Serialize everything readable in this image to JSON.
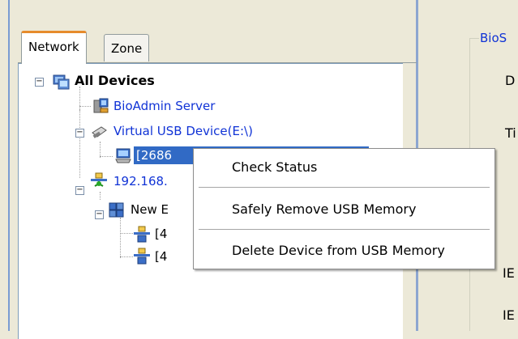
{
  "tabs": [
    {
      "label": "Network",
      "active": true
    },
    {
      "label": "Zone",
      "active": false
    }
  ],
  "tree": {
    "root": {
      "label": "All Devices",
      "expander": "⊟"
    },
    "server": {
      "label": "BioAdmin Server"
    },
    "usb": {
      "label": "Virtual USB Device(E:\\)"
    },
    "usb_child": {
      "label": "[2686"
    },
    "network": {
      "label": "192.168."
    },
    "group": {
      "label": "New E"
    },
    "dev1": {
      "label": "[4"
    },
    "dev2": {
      "label": "[4"
    }
  },
  "context_menu": {
    "items": [
      {
        "label": "Check Status"
      },
      {
        "label": "Safely Remove USB Memory"
      },
      {
        "label": "Delete Device from USB Memory"
      }
    ]
  },
  "right_panel": {
    "group_title": "BioS",
    "field_letters": [
      "D",
      "Ti",
      "IE",
      "IE"
    ]
  },
  "colors": {
    "tab_accent": "#e68b2c",
    "link_blue": "#1033d6",
    "window_bg": "#ece9d8",
    "frame_blue": "#7a9cd3"
  }
}
